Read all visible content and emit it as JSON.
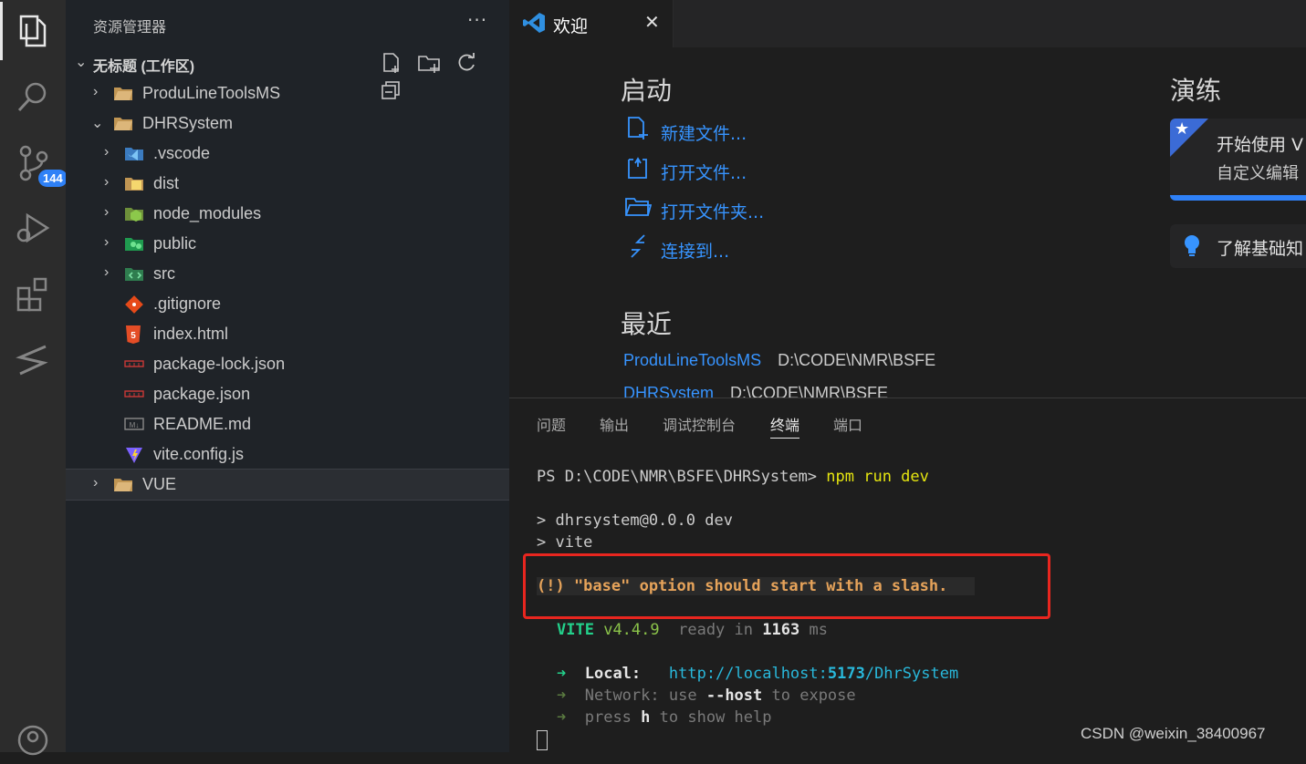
{
  "sidebar": {
    "title": "资源管理器",
    "more": "···",
    "workspace": "无标题 (工作区)",
    "items": [
      {
        "label": "ProduLineToolsMS",
        "chev": "›",
        "icon": "folder-icon"
      },
      {
        "label": "DHRSystem",
        "chev": "⌄",
        "icon": "folder-open-icon"
      },
      {
        "label": ".vscode",
        "chev": "›",
        "icon": "vscode-folder-icon"
      },
      {
        "label": "dist",
        "chev": "›",
        "icon": "dist-folder-icon"
      },
      {
        "label": "node_modules",
        "chev": "›",
        "icon": "node-folder-icon"
      },
      {
        "label": "public",
        "chev": "›",
        "icon": "public-folder-icon"
      },
      {
        "label": "src",
        "chev": "›",
        "icon": "src-folder-icon"
      },
      {
        "label": ".gitignore",
        "icon": "git-file-icon"
      },
      {
        "label": "index.html",
        "icon": "html5-file-icon"
      },
      {
        "label": "package-lock.json",
        "icon": "npm-file-icon"
      },
      {
        "label": "package.json",
        "icon": "npm-file-icon"
      },
      {
        "label": "README.md",
        "icon": "markdown-file-icon"
      },
      {
        "label": "vite.config.js",
        "icon": "vite-file-icon"
      },
      {
        "label": "VUE",
        "chev": "›",
        "icon": "folder-icon"
      }
    ]
  },
  "activity": {
    "scm_badge": "144"
  },
  "tab": {
    "label": "欢迎",
    "close": "✕"
  },
  "welcome": {
    "start_heading": "启动",
    "start_links": [
      "新建文件...",
      "打开文件...",
      "打开文件夹...",
      "连接到..."
    ],
    "recent_heading": "最近",
    "recent": [
      {
        "name": "ProduLineToolsMS",
        "path": "D:\\CODE\\NMR\\BSFE"
      },
      {
        "name": "DHRSystem",
        "path": "D:\\CODE\\NMR\\BSFE"
      }
    ],
    "walkthrough_heading": "演练",
    "walk_card_title": "开始使用 V",
    "walk_card_sub": "自定义编辑",
    "walk_card2": "了解基础知"
  },
  "panel": {
    "tabs": [
      "问题",
      "输出",
      "调试控制台",
      "终端",
      "端口"
    ],
    "active_tab": "终端",
    "terminal": {
      "prompt": "PS D:\\CODE\\NMR\\BSFE\\DHRSystem>",
      "command": "npm run dev",
      "line1": "> dhrsystem@0.0.0 dev",
      "line2": "> vite",
      "warning": "(!) \"base\" option should start with a slash.",
      "vite": "VITE",
      "vite_version": "v4.4.9",
      "ready": "ready in",
      "ready_ms": "1163",
      "ms": "ms",
      "arrow": "➜",
      "local_label": "Local:",
      "local_url_prefix": "http://localhost:",
      "local_port": "5173",
      "local_path": "/DhrSystem",
      "network_label": "Network:",
      "network_use": "use",
      "network_flag": "--host",
      "network_rest": "to expose",
      "press": "press",
      "press_key": "h",
      "press_rest": "to show help"
    }
  },
  "watermark": "CSDN @weixin_38400967"
}
